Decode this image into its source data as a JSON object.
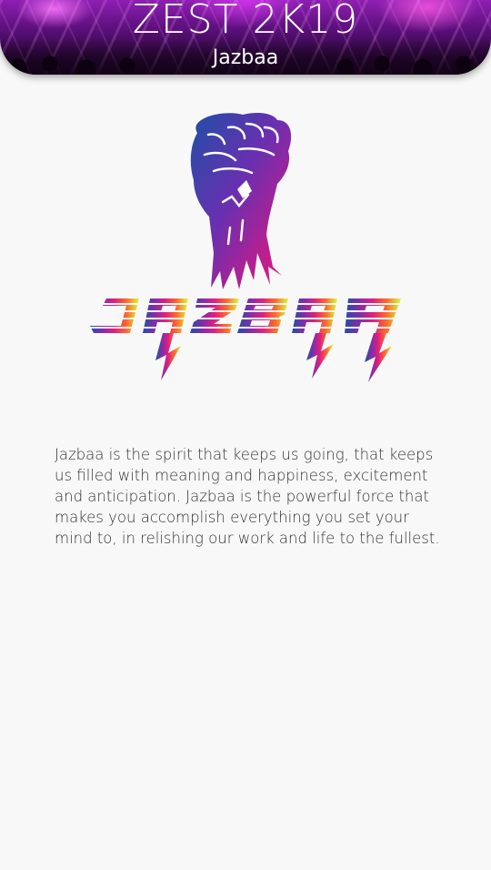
{
  "header": {
    "title": "ZEST 2K19",
    "subtitle": "Jazbaa"
  },
  "logo": {
    "icon": "raised-fist-icon",
    "wordmark": "JAZBAA",
    "gradient_colors": [
      "#1f4fa6",
      "#8a2ba8",
      "#e0207a",
      "#ff6a2a",
      "#d8ff3a"
    ]
  },
  "description": "Jazbaa is the spirit that keeps us going, that keeps\nus filled with meaning and happiness, excitement\nand anticipation. Jazbaa is the powerful force that\nmakes you accomplish everything you set your\nmind to, in relishing our work and life to the fullest."
}
